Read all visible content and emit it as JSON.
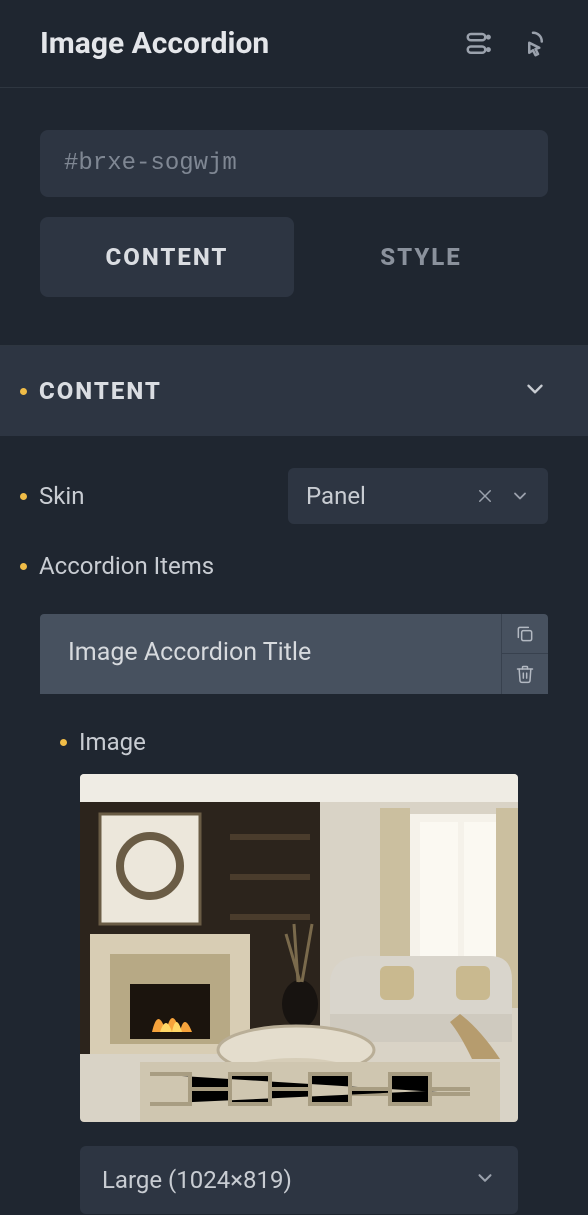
{
  "header": {
    "title": "Image Accordion"
  },
  "element_id": "#brxe-sogwjm",
  "tabs": {
    "content_label": "CONTENT",
    "style_label": "STYLE"
  },
  "section": {
    "title": "CONTENT"
  },
  "controls": {
    "skin_label": "Skin",
    "skin_value": "Panel",
    "accordion_items_label": "Accordion Items"
  },
  "item": {
    "title": "Image Accordion Title",
    "image_label": "Image",
    "size_value": "Large (1024×819)"
  }
}
